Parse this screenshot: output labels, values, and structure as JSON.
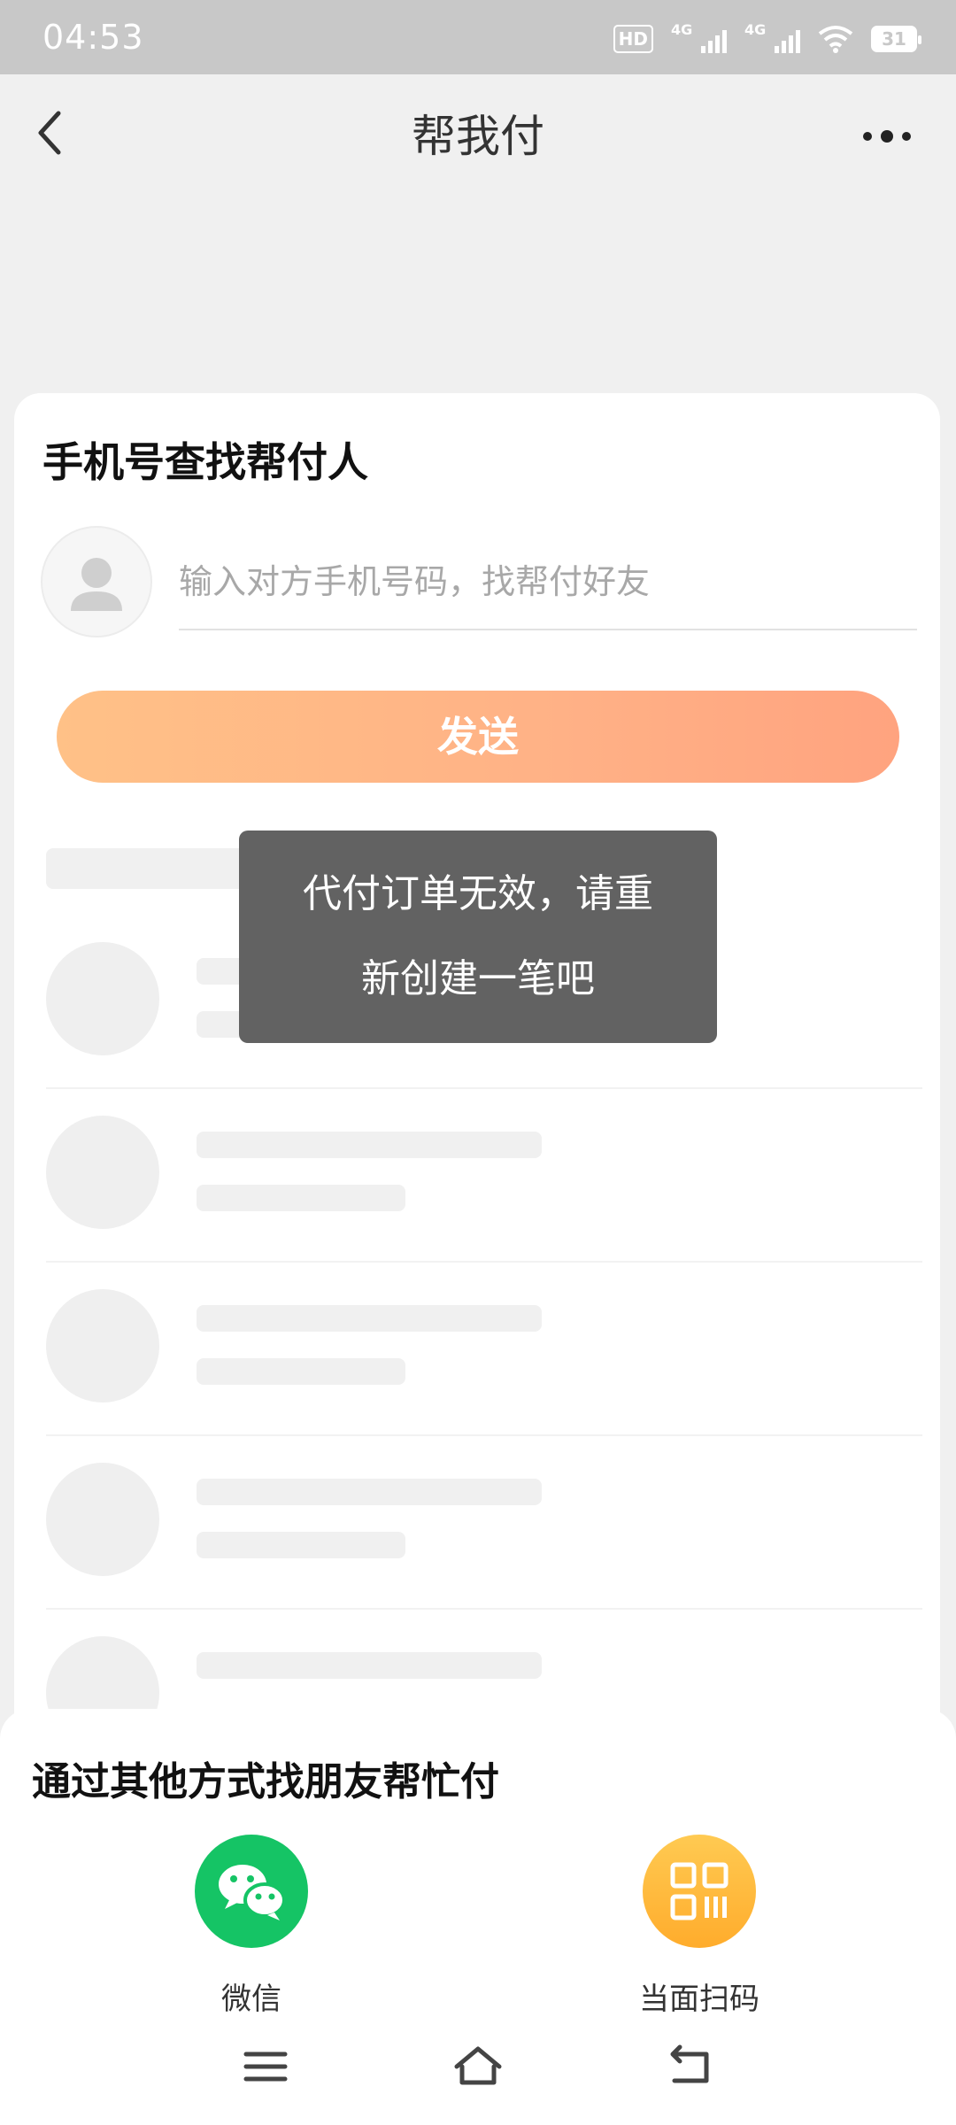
{
  "status_bar": {
    "time": "04:53",
    "hd_badge": "HD",
    "sim1": "4G",
    "sim2": "4G",
    "battery": "31"
  },
  "header": {
    "title": "帮我付"
  },
  "search_card": {
    "title": "手机号查找帮付人",
    "phone_placeholder": "输入对方手机号码，找帮付好友",
    "phone_value": "",
    "send_label": "发送"
  },
  "toast": {
    "line1": "代付订单无效，请重",
    "line2": "新创建一笔吧"
  },
  "bottom_sheet": {
    "title": "通过其他方式找朋友帮忙付",
    "options": [
      {
        "label": "微信",
        "icon": "wechat-icon",
        "color": "#15c465"
      },
      {
        "label": "当面扫码",
        "icon": "qr-code-icon",
        "color": "#ffb43a"
      }
    ]
  },
  "colors": {
    "accent_orange": "#ffb186",
    "status_bar_bg": "#c8c8c8",
    "toast_bg": "#5a5a5a"
  }
}
